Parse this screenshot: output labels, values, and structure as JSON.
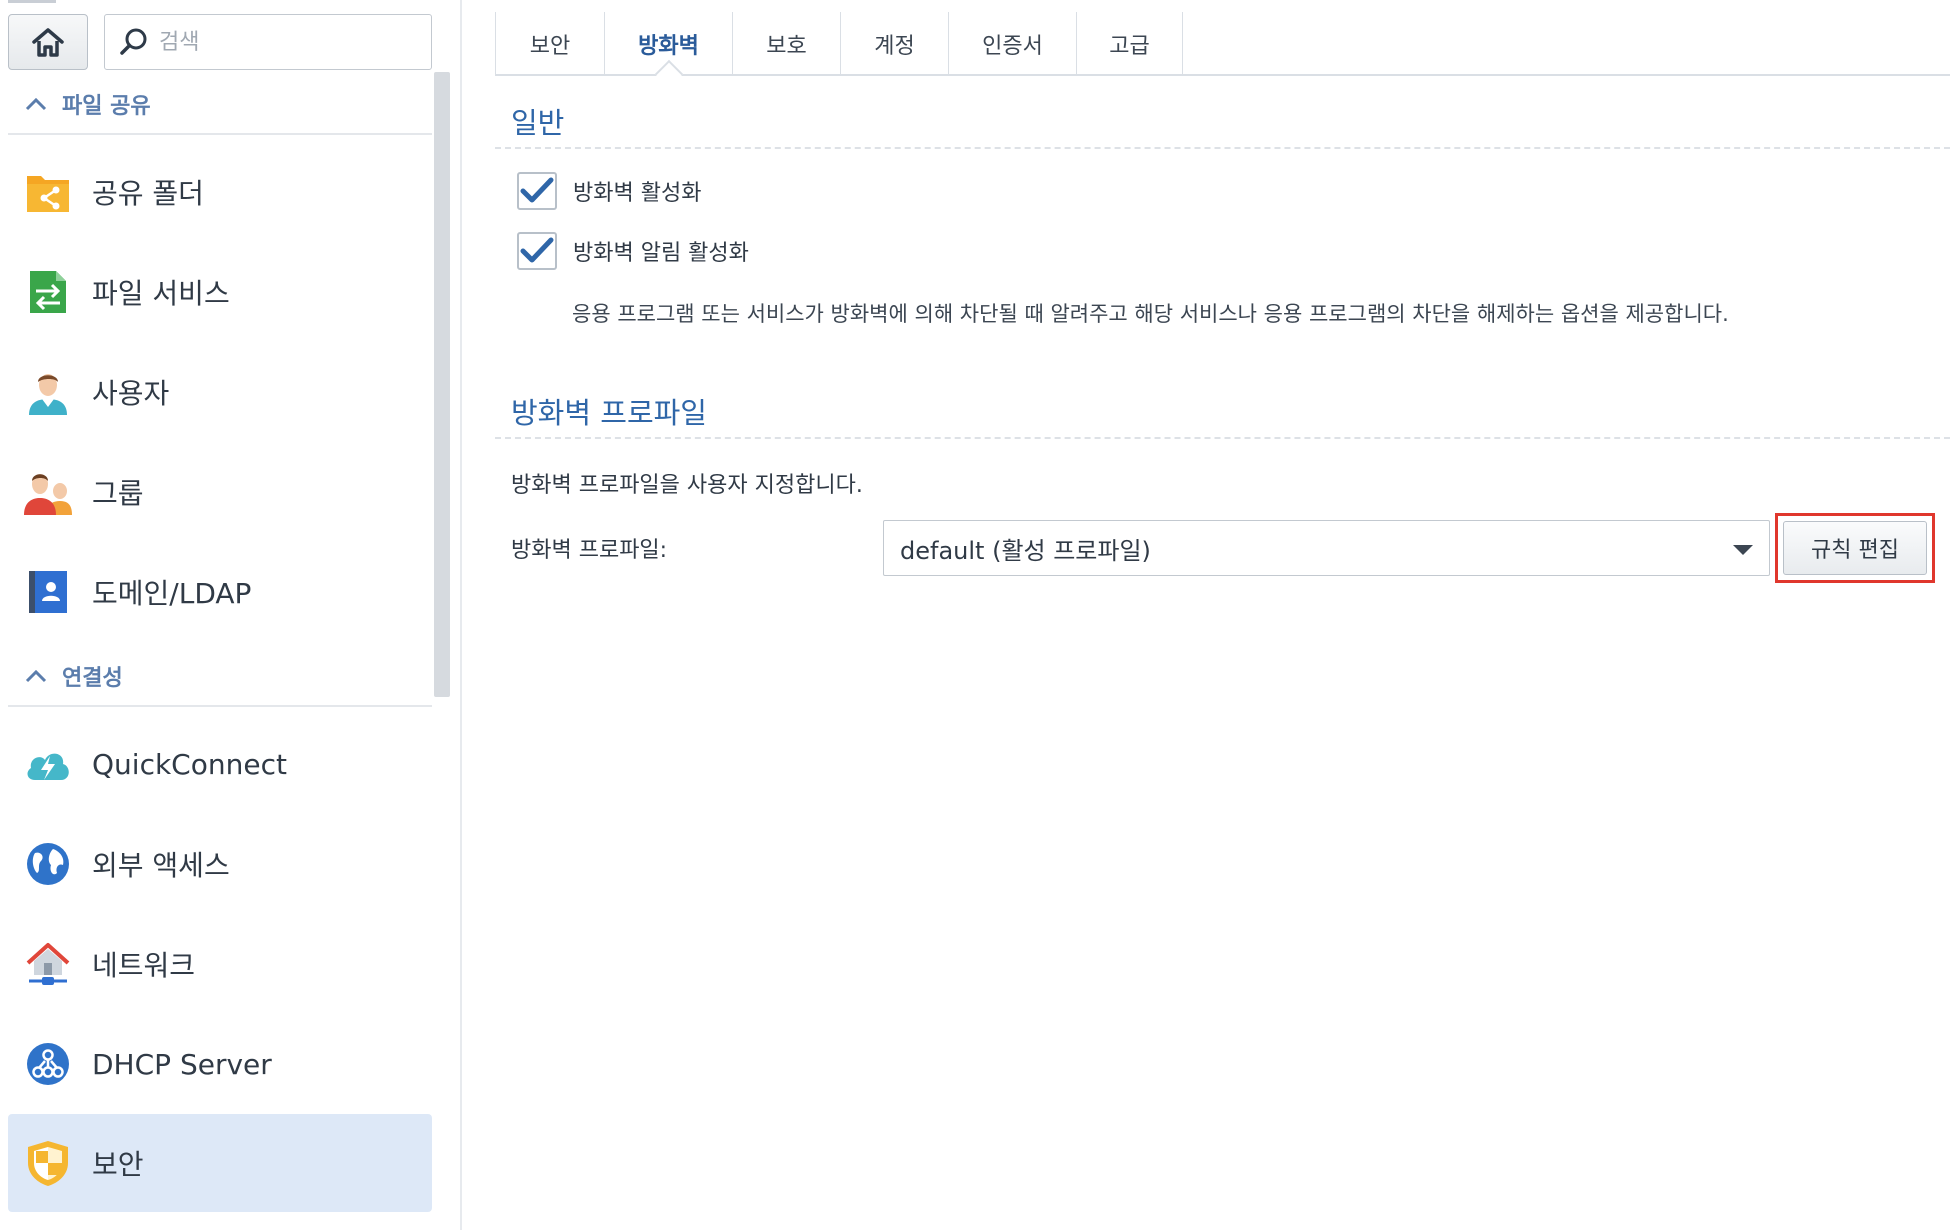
{
  "sidebar": {
    "search": {
      "placeholder": "검색"
    },
    "sections": [
      {
        "label": "파일 공유"
      },
      {
        "label": "연결성"
      }
    ],
    "items": [
      {
        "label": "공유 폴더",
        "icon": "shared-folder-icon"
      },
      {
        "label": "파일 서비스",
        "icon": "file-services-icon"
      },
      {
        "label": "사용자",
        "icon": "user-icon"
      },
      {
        "label": "그룹",
        "icon": "group-icon"
      },
      {
        "label": "도메인/LDAP",
        "icon": "domain-ldap-icon"
      },
      {
        "label": "QuickConnect",
        "icon": "quickconnect-icon"
      },
      {
        "label": "외부 액세스",
        "icon": "external-access-icon"
      },
      {
        "label": "네트워크",
        "icon": "network-icon"
      },
      {
        "label": "DHCP Server",
        "icon": "dhcp-server-icon"
      },
      {
        "label": "보안",
        "icon": "security-shield-icon",
        "active": true
      }
    ]
  },
  "tabs": [
    {
      "label": "보안"
    },
    {
      "label": "방화벽",
      "active": true
    },
    {
      "label": "보호"
    },
    {
      "label": "계정"
    },
    {
      "label": "인증서"
    },
    {
      "label": "고급"
    }
  ],
  "general": {
    "title": "일반",
    "enable_firewall": {
      "label": "방화벽 활성화",
      "checked": true
    },
    "enable_notifications": {
      "label": "방화벽 알림 활성화",
      "checked": true
    },
    "description": "응용 프로그램 또는 서비스가 방화벽에 의해 차단될 때 알려주고 해당 서비스나 응용 프로그램의 차단을 해제하는 옵션을 제공합니다."
  },
  "profile": {
    "title": "방화벽 프로파일",
    "description": "방화벽 프로파일을 사용자 지정합니다.",
    "field_label": "방화벽 프로파일:",
    "selected": "default (활성 프로파일)",
    "edit_button": "규칙 편집"
  },
  "colors": {
    "accent": "#2f66a8",
    "active_bg": "#dde8f7",
    "highlight": "#e0372d"
  }
}
